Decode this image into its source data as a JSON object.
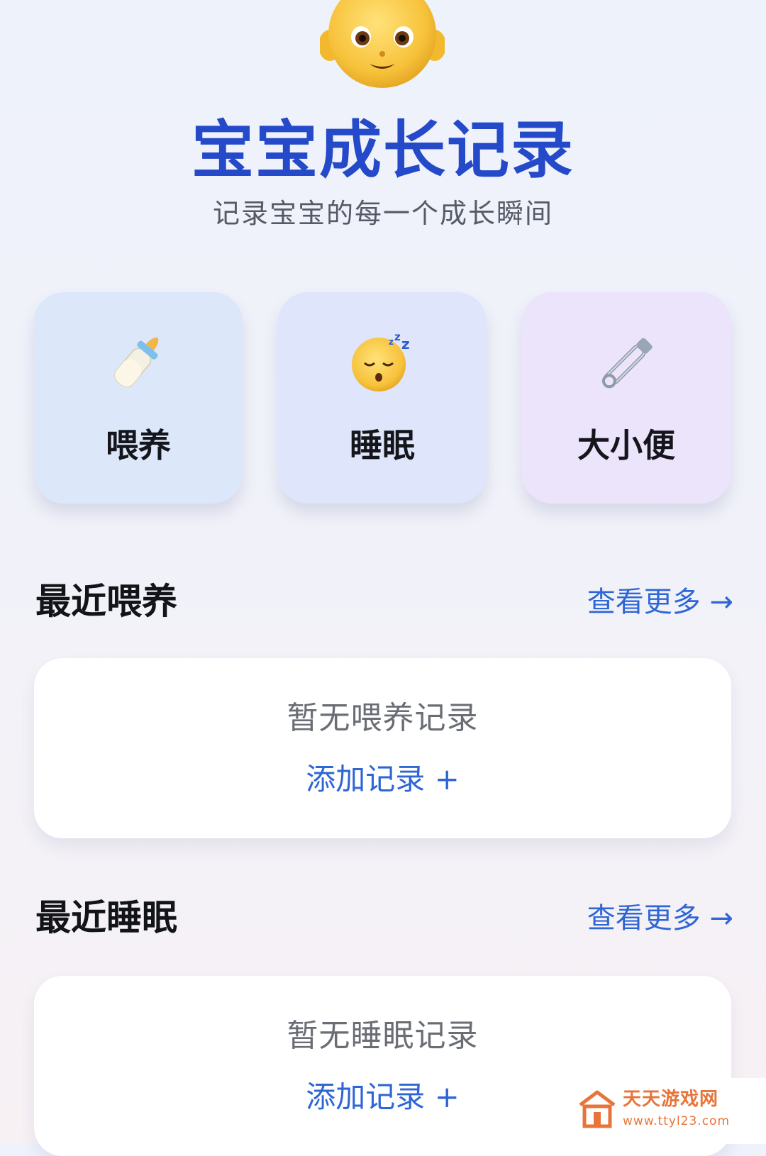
{
  "header": {
    "icon": "baby-face-emoji",
    "title": "宝宝成长记录",
    "subtitle": "记录宝宝的每一个成长瞬间"
  },
  "categories": [
    {
      "label": "喂养",
      "icon": "baby-bottle-icon"
    },
    {
      "label": "睡眠",
      "icon": "sleeping-face-icon"
    },
    {
      "label": "大小便",
      "icon": "safety-pin-icon"
    }
  ],
  "sections": {
    "feeding": {
      "title": "最近喂养",
      "view_more": "查看更多 →",
      "empty_text": "暂无喂养记录",
      "add_label": "添加记录 +"
    },
    "sleep": {
      "title": "最近睡眠",
      "view_more": "查看更多 →",
      "empty_text": "暂无睡眠记录",
      "add_label": "添加记录 +"
    }
  },
  "watermark": {
    "name": "天天游戏网",
    "url": "www.ttyl23.com"
  },
  "colors": {
    "title_blue": "#2449c9",
    "link_blue": "#2f66d6",
    "card_feeding": "#dce8fa",
    "card_sleep": "#dfe5fa",
    "card_diaper": "#ebe4fb",
    "watermark_orange": "#e8743a"
  }
}
